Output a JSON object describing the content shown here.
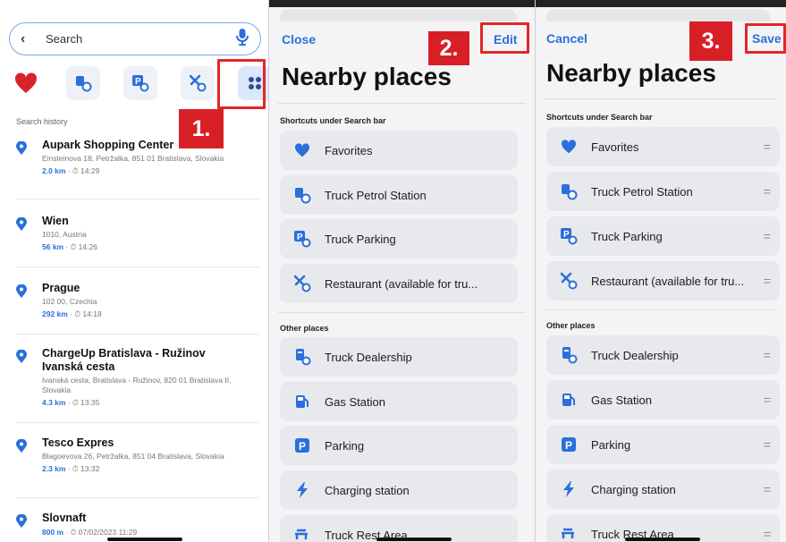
{
  "colors": {
    "accent": "#2a6fdb",
    "marker": "#d81f26",
    "heart": "#d8232a",
    "icon_blue": "#2a6fdb"
  },
  "search": {
    "placeholder": "Search",
    "back_icon": "chevron-left-icon",
    "mic_icon": "microphone-icon"
  },
  "quick_icons": [
    "heart-icon",
    "truck-petrol-icon",
    "truck-parking-icon",
    "restaurant-icon",
    "apps-grid-icon"
  ],
  "history": {
    "title": "Search history",
    "items": [
      {
        "title": "Aupark Shopping Center",
        "address": "Einsteinova 18, Petržalka, 851 01 Bratislava, Slovakia",
        "distance": "2.0 km",
        "time": "· ⏱ 14:29"
      },
      {
        "title": "Wien",
        "address": "1010, Austria",
        "distance": "56 km",
        "time": "· ⏱ 14:26"
      },
      {
        "title": "Prague",
        "address": "102 00, Czechia",
        "distance": "292 km",
        "time": "· ⏱ 14:18"
      },
      {
        "title": "ChargeUp Bratislava - Ružinov Ivanská cesta",
        "address": "Ivanská cesta, Bratislava - Ružinov, 820 01 Bratislava II, Slovakia",
        "distance": "4.3 km",
        "time": "· ⏱ 13:35"
      },
      {
        "title": "Tesco Expres",
        "address": "Blagoevova 26, Petržalka, 851 04 Bratislava, Slovakia",
        "distance": "2.3 km",
        "time": "· ⏱ 13:32"
      },
      {
        "title": "Slovnaft",
        "address": "",
        "distance": "800 m",
        "time": "· ⏱ 07/02/2023 11:29"
      }
    ]
  },
  "steps": {
    "one": "1.",
    "two": "2.",
    "three": "3."
  },
  "edit_panel": {
    "left_button": "Close",
    "right_button": "Edit",
    "title": "Nearby places"
  },
  "reorder_panel": {
    "left_button": "Cancel",
    "right_button": "Save",
    "title": "Nearby places"
  },
  "sections": {
    "shortcuts": "Shortcuts under Search bar",
    "other": "Other places"
  },
  "shortcuts": [
    {
      "label": "Favorites",
      "icon": "heart-icon"
    },
    {
      "label": "Truck Petrol Station",
      "icon": "truck-petrol-icon"
    },
    {
      "label": "Truck Parking",
      "icon": "truck-parking-icon"
    },
    {
      "label": "Restaurant (available for tru...",
      "icon": "restaurant-icon"
    }
  ],
  "shortcuts_reorder": [
    {
      "label": "Favorites",
      "icon": "heart-icon"
    },
    {
      "label": "Truck Petrol Station",
      "icon": "truck-petrol-icon"
    },
    {
      "label": "Truck Parking",
      "icon": "truck-parking-icon"
    },
    {
      "label": "Restaurant (available for tru...",
      "icon": "restaurant-icon"
    }
  ],
  "other_places": [
    {
      "label": "Truck Dealership",
      "icon": "truck-dealership-icon"
    },
    {
      "label": "Gas Station",
      "icon": "gas-station-icon"
    },
    {
      "label": "Parking",
      "icon": "parking-icon"
    },
    {
      "label": "Charging station",
      "icon": "charging-bolt-icon"
    },
    {
      "label": "Truck Rest Area",
      "icon": "truck-rest-area-icon"
    }
  ],
  "drag_handle": "="
}
